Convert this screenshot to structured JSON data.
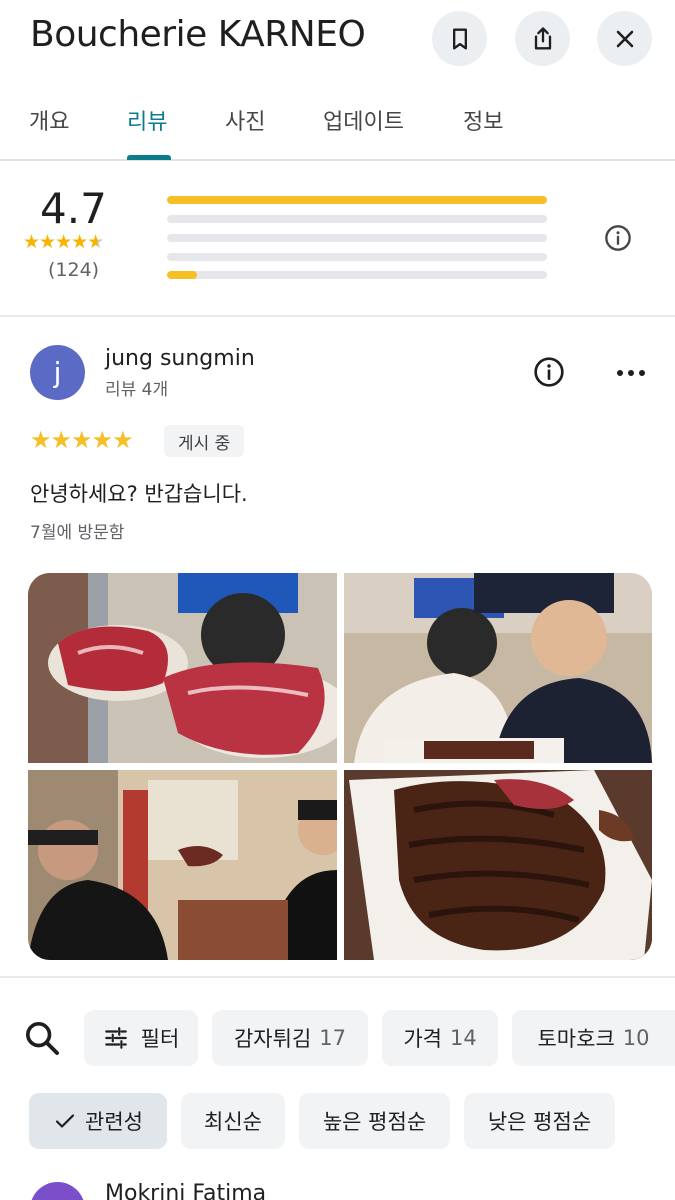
{
  "header": {
    "title": "Boucherie KARNEO",
    "icons": [
      "bookmark-icon",
      "share-icon",
      "close-icon"
    ]
  },
  "tabs": [
    {
      "label": "개요",
      "active": false
    },
    {
      "label": "리뷰",
      "active": true
    },
    {
      "label": "사진",
      "active": false
    },
    {
      "label": "업데이트",
      "active": false
    },
    {
      "label": "정보",
      "active": false
    }
  ],
  "colors": {
    "accent": "#0b7d8a",
    "star": "#f6bf26",
    "avatar_j": "#5b6ac4",
    "avatar_m": "#7b4fc9"
  },
  "rating_summary": {
    "average": "4.7",
    "stars": 4.7,
    "total": "(124)",
    "distribution": [
      {
        "stars": 5,
        "fraction": 1.0
      },
      {
        "stars": 4,
        "fraction": 0.0
      },
      {
        "stars": 3,
        "fraction": 0.0
      },
      {
        "stars": 2,
        "fraction": 0.0
      },
      {
        "stars": 1,
        "fraction": 0.08
      }
    ]
  },
  "review": {
    "avatar_letter": "j",
    "name": "jung sungmin",
    "meta": "리뷰 4개",
    "stars": 5,
    "status": "게시 중",
    "text": "안녕하세요? 반갑습니다.",
    "visit": "7월에 방문함",
    "photos": [
      "photo-raw-steaks",
      "photo-two-men-at-table",
      "photo-diners-with-steak",
      "photo-sliced-steak"
    ]
  },
  "filters": {
    "search_icon": "search-icon",
    "filter_label": "필터",
    "topics": [
      {
        "label": "감자튀김",
        "count": "17"
      },
      {
        "label": "가격",
        "count": "14"
      },
      {
        "label": "토마호크",
        "count": "10"
      }
    ]
  },
  "sort": {
    "options": [
      {
        "label": "관련성",
        "selected": true
      },
      {
        "label": "최신순",
        "selected": false
      },
      {
        "label": "높은 평점순",
        "selected": false
      },
      {
        "label": "낮은 평점순",
        "selected": false
      }
    ]
  },
  "next_review": {
    "name": "Mokrini Fatima"
  }
}
